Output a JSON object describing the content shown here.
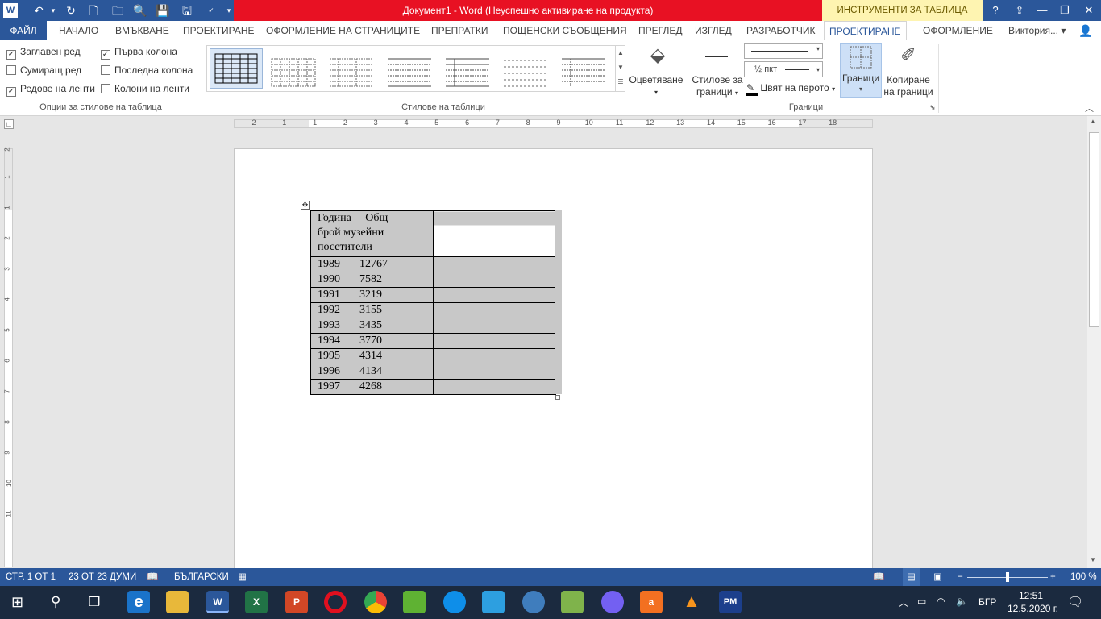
{
  "titlebar": {
    "title": "Документ1 -  Word (Неуспешно активиране на продукта)",
    "context_tools": "ИНСТРУМЕНТИ ЗА ТАБЛИЦА",
    "help": "?"
  },
  "tabs": {
    "file": "ФАЙЛ",
    "items": [
      "НАЧАЛО",
      "ВМЪКВАНЕ",
      "ПРОЕКТИРАНЕ",
      "ОФОРМЛЕНИЕ НА СТРАНИЦИТЕ",
      "ПРЕПРАТКИ",
      "ПОЩЕНСКИ СЪОБЩЕНИЯ",
      "ПРЕГЛЕД",
      "ИЗГЛЕД",
      "РАЗРАБОТЧИК",
      "ПРОЕКТИРАНЕ",
      "ОФОРМЛЕНИЕ"
    ],
    "user": "Виктория..."
  },
  "ribbon": {
    "options": {
      "header_row": "Заглавен ред",
      "first_column": "Първа колона",
      "total_row": "Сумиращ ред",
      "last_column": "Последна колона",
      "banded_rows": "Редове на ленти",
      "banded_columns": "Колони на ленти",
      "group_label": "Опции за стилове на таблица"
    },
    "styles_group_label": "Стилове на таблици",
    "shading": "Оцветяване",
    "border_styles_1": "Стилове за",
    "border_styles_2": "граници",
    "pen_weight": "½ пкт",
    "pen_color": "Цвят на перото",
    "borders": "Граници",
    "border_painter_1": "Копиране",
    "border_painter_2": "на граници",
    "borders_group_label": "Граници"
  },
  "ruler": {
    "top": [
      "2",
      "1",
      "1",
      "2",
      "3",
      "4",
      "5",
      "6",
      "7",
      "8",
      "9",
      "10",
      "11",
      "12",
      "13",
      "14",
      "15",
      "16",
      "17",
      "18"
    ],
    "left": [
      "2",
      "1",
      "1",
      "2",
      "3",
      "4",
      "5",
      "6",
      "7",
      "8",
      "9",
      "10",
      "11"
    ]
  },
  "table": {
    "header_line1_a": "Година",
    "header_line1_b": "Общ",
    "header_line2": "брой музейни",
    "header_line3": "посетители",
    "rows": [
      {
        "year": "1989",
        "value": "12767"
      },
      {
        "year": "1990",
        "value": "7582"
      },
      {
        "year": "1991",
        "value": "3219"
      },
      {
        "year": "1992",
        "value": "3155"
      },
      {
        "year": "1993",
        "value": "3435"
      },
      {
        "year": "1994",
        "value": "3770"
      },
      {
        "year": "1995",
        "value": "4314"
      },
      {
        "year": "1996",
        "value": "4134"
      },
      {
        "year": "1997",
        "value": "4268"
      }
    ]
  },
  "status": {
    "page": "СТР. 1 ОТ 1",
    "words": "23 ОТ 23 ДУМИ",
    "language": "БЪЛГАРСКИ",
    "zoom": "100 %"
  },
  "taskbar": {
    "lang": "БГР",
    "time": "12:51",
    "date": "12.5.2020 г."
  },
  "colors": {
    "word_blue": "#2b579a",
    "title_red": "#e81123",
    "context_yellow": "#fef4b1",
    "table_shading": "#c8c8c8"
  }
}
